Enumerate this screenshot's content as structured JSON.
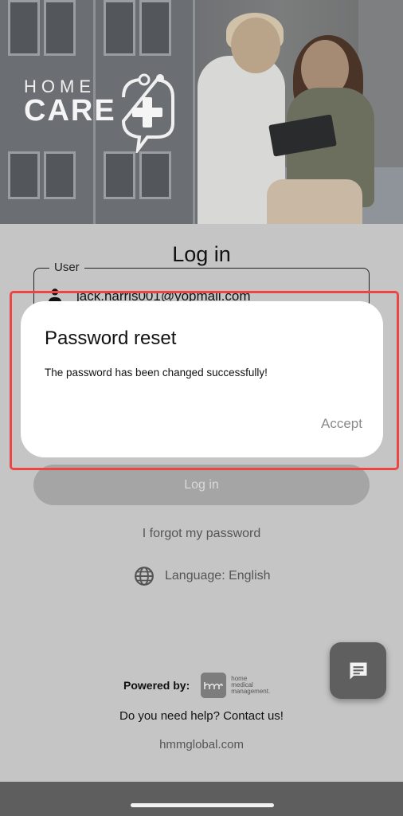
{
  "hero": {
    "logo_home": "HOME",
    "logo_care": "CARE"
  },
  "login": {
    "title": "Log in",
    "user_label": "User",
    "user_value": "jack.harris001@yopmail.com",
    "login_button": "Log in",
    "forgot_password": "I forgot my password",
    "language": "Language: English"
  },
  "footer": {
    "powered_by": "Powered by:",
    "hmm_logo_text": [
      "home",
      "medical",
      "management."
    ],
    "help": "Do you need help? Contact us!",
    "website": "hmmglobal.com"
  },
  "dialog": {
    "title": "Password reset",
    "message": "The password has been changed successfully!",
    "accept": "Accept"
  },
  "colors": {
    "highlight": "#ef4444",
    "background": "#c5c5c5",
    "button": "#a5a5a5",
    "fab": "#5f5f5f"
  },
  "icons": {
    "user": "person-icon",
    "language": "globe-icon",
    "chat": "chat-bubble-icon",
    "logo": "plus-speech-bubble-icon"
  }
}
